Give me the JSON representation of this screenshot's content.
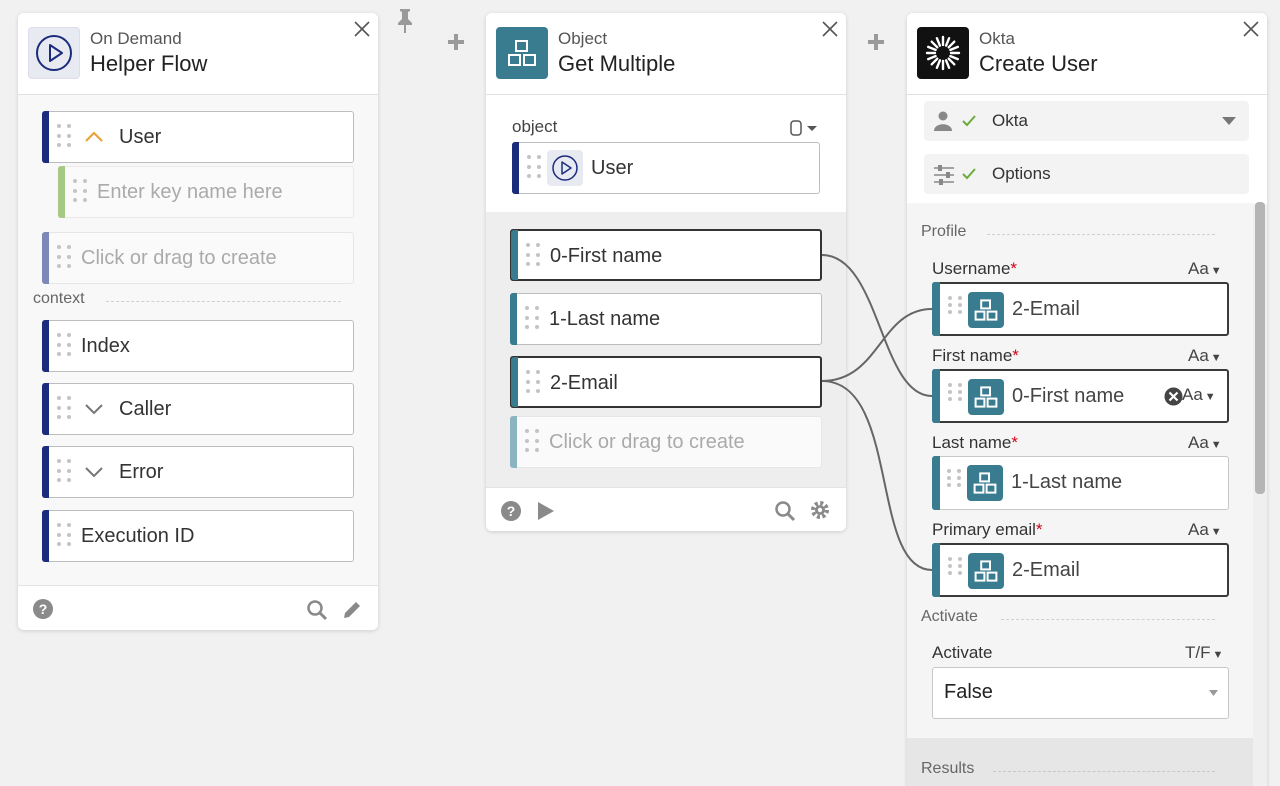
{
  "colors": {
    "accent_navy": "#1b2c7d",
    "object_teal": "#3a7c8f",
    "key_green": "#a6c983",
    "required_red": "#d0021b",
    "check_green": "#6bab3c",
    "chevron_orange": "#e8a33c"
  },
  "card1": {
    "app_label": "On Demand",
    "title": "Helper Flow",
    "icon": "play-circle-icon",
    "items": {
      "user": "User",
      "key_placeholder": "Enter key name here",
      "create1": "Click or drag to create"
    },
    "context_label": "context",
    "context_items": [
      "Index",
      "Caller",
      "Error",
      "Execution ID"
    ]
  },
  "card2": {
    "app_label": "Object",
    "title": "Get Multiple",
    "icon": "object-blocks-icon",
    "object_label": "object",
    "object_value": "User",
    "outputs": [
      "0-First name",
      "1-Last name",
      "2-Email"
    ],
    "create": "Click or drag to create"
  },
  "card3": {
    "app_label": "Okta",
    "title": "Create User",
    "icon": "okta-logo-icon",
    "connection": "Okta",
    "options": "Options",
    "profile_label": "Profile",
    "fields": [
      {
        "label": "Username",
        "type": "Aa",
        "value": "2-Email"
      },
      {
        "label": "First name",
        "type": "Aa",
        "value": "0-First name"
      },
      {
        "label": "Last name",
        "type": "Aa",
        "value": "1-Last name"
      },
      {
        "label": "Primary email",
        "type": "Aa",
        "value": "2-Email"
      }
    ],
    "required_mark": "*",
    "activate_section": "Activate",
    "activate_label": "Activate",
    "activate_type": "T/F",
    "activate_value": "False",
    "results_label": "Results"
  }
}
